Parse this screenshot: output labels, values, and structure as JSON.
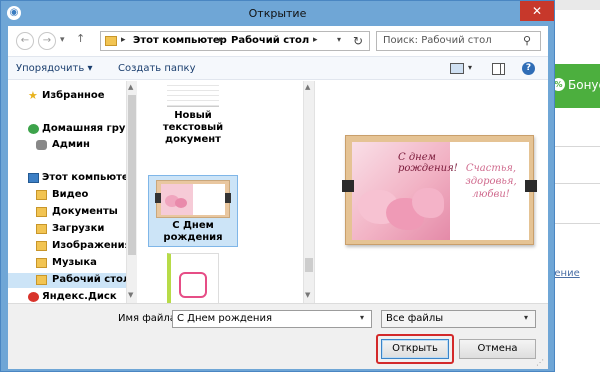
{
  "background": {
    "bonus_label": "Бонус",
    "link_text": "ление"
  },
  "dialog": {
    "title": "Открытие",
    "close_symbol": "✕"
  },
  "address": {
    "crumbs": [
      "Этот компьютер",
      "Рабочий стол"
    ],
    "separator": "▸",
    "search_placeholder": "Поиск: Рабочий стол"
  },
  "toolbar": {
    "organize_label": "Упорядочить ▾",
    "new_folder_label": "Создать папку"
  },
  "nav": {
    "items": [
      {
        "label": "Избранное",
        "icon": "star-icon",
        "bold": true
      },
      {
        "label": "Домашняя группа",
        "icon": "homegroup-icon",
        "bold": true
      },
      {
        "label": "Админ",
        "icon": "user-icon",
        "bold": true
      },
      {
        "label": "Этот компьютер",
        "icon": "computer-icon",
        "bold": true
      },
      {
        "label": "Видео",
        "icon": "folder-icon",
        "bold": true
      },
      {
        "label": "Документы",
        "icon": "folder-icon",
        "bold": true
      },
      {
        "label": "Загрузки",
        "icon": "folder-icon",
        "bold": true
      },
      {
        "label": "Изображения",
        "icon": "folder-icon",
        "bold": true
      },
      {
        "label": "Музыка",
        "icon": "folder-icon",
        "bold": true
      },
      {
        "label": "Рабочий стол",
        "icon": "folder-icon",
        "bold": true,
        "selected": true
      },
      {
        "label": "Яндекс.Диск",
        "icon": "disk-icon",
        "bold": true
      }
    ]
  },
  "files": {
    "items": [
      {
        "name": "Новый текстовый документ"
      },
      {
        "name": "С Днем рождения",
        "selected": true
      },
      {
        "name": ""
      }
    ]
  },
  "preview": {
    "photo_text_1": "С днем",
    "photo_text_2": "рождения!",
    "wish_1": "Счастья,",
    "wish_2": "здоровья,",
    "wish_3": "любви!"
  },
  "bottom": {
    "filename_label": "Имя файла:",
    "filename_value": "С Днем рождения",
    "filetype_value": "Все файлы",
    "open_label": "Открыть",
    "cancel_label": "Отмена"
  },
  "colors": {
    "accent_highlight": "#d3292a",
    "selection": "#cce4f7",
    "titlebar": "#6fa6d6",
    "close_button": "#c7382b"
  }
}
